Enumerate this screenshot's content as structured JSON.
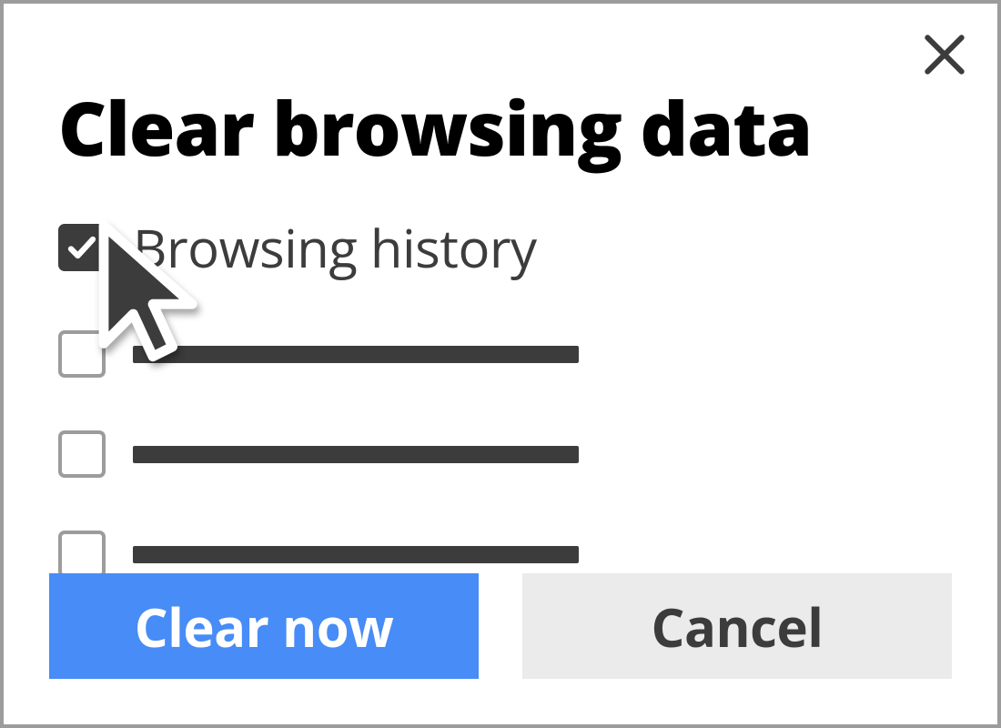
{
  "dialog": {
    "title": "Clear browsing data",
    "options": [
      {
        "checked": true,
        "label": "Browsing history",
        "placeholder": false
      },
      {
        "checked": false,
        "label": "",
        "placeholder": true
      },
      {
        "checked": false,
        "label": "",
        "placeholder": true
      },
      {
        "checked": false,
        "label": "",
        "placeholder": true
      }
    ],
    "primary_button": "Clear now",
    "secondary_button": "Cancel"
  },
  "colors": {
    "primary_button_bg": "#478cf7",
    "secondary_button_bg": "#ebebeb",
    "text_dark": "#3c3c3c",
    "border_gray": "#9c9c9c"
  },
  "icons": {
    "close": "close-icon",
    "check": "check-icon",
    "cursor": "cursor-pointer-icon"
  }
}
